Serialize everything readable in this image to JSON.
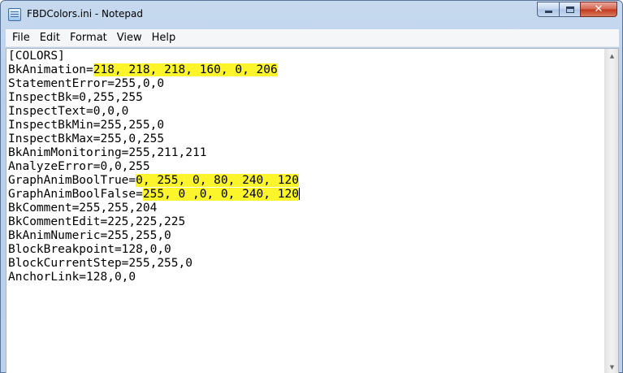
{
  "window": {
    "title": "FBDColors.ini - Notepad"
  },
  "caption_buttons": {
    "minimize_icon": "minimize-icon",
    "maximize_icon": "maximize-icon",
    "close_icon": "close-icon",
    "close_glyph": "✕"
  },
  "menu": {
    "items": [
      "File",
      "Edit",
      "Format",
      "View",
      "Help"
    ]
  },
  "editor": {
    "highlight_color": "#fdf52c",
    "lines": [
      {
        "plain": "[COLORS]"
      },
      {
        "plain": "BkAnimation=",
        "highlighted": "218, 218, 218, 160, 0, 206"
      },
      {
        "plain": "StatementError=255,0,0"
      },
      {
        "plain": "InspectBk=0,255,255"
      },
      {
        "plain": "InspectText=0,0,0"
      },
      {
        "plain": "InspectBkMin=255,255,0"
      },
      {
        "plain": "InspectBkMax=255,0,255"
      },
      {
        "plain": "BkAnimMonitoring=255,211,211"
      },
      {
        "plain": "AnalyzeError=0,0,255"
      },
      {
        "plain": "GraphAnimBoolTrue=",
        "highlighted": "0, 255, 0, 80, 240, 120"
      },
      {
        "plain": "GraphAnimBoolFalse=",
        "highlighted": "255, 0 ,0, 0, 240, 120"
      },
      {
        "plain": "BkComment=255,255,204"
      },
      {
        "plain": "BkCommentEdit=225,225,225"
      },
      {
        "plain": "BkAnimNumeric=255,255,0"
      },
      {
        "plain": "BlockBreakpoint=128,0,0"
      },
      {
        "plain": "BlockCurrentStep=255,255,0"
      },
      {
        "plain": "AnchorLink=128,0,0"
      }
    ]
  },
  "scrollbar": {
    "up_arrow": "▲",
    "down_arrow": "▼"
  }
}
